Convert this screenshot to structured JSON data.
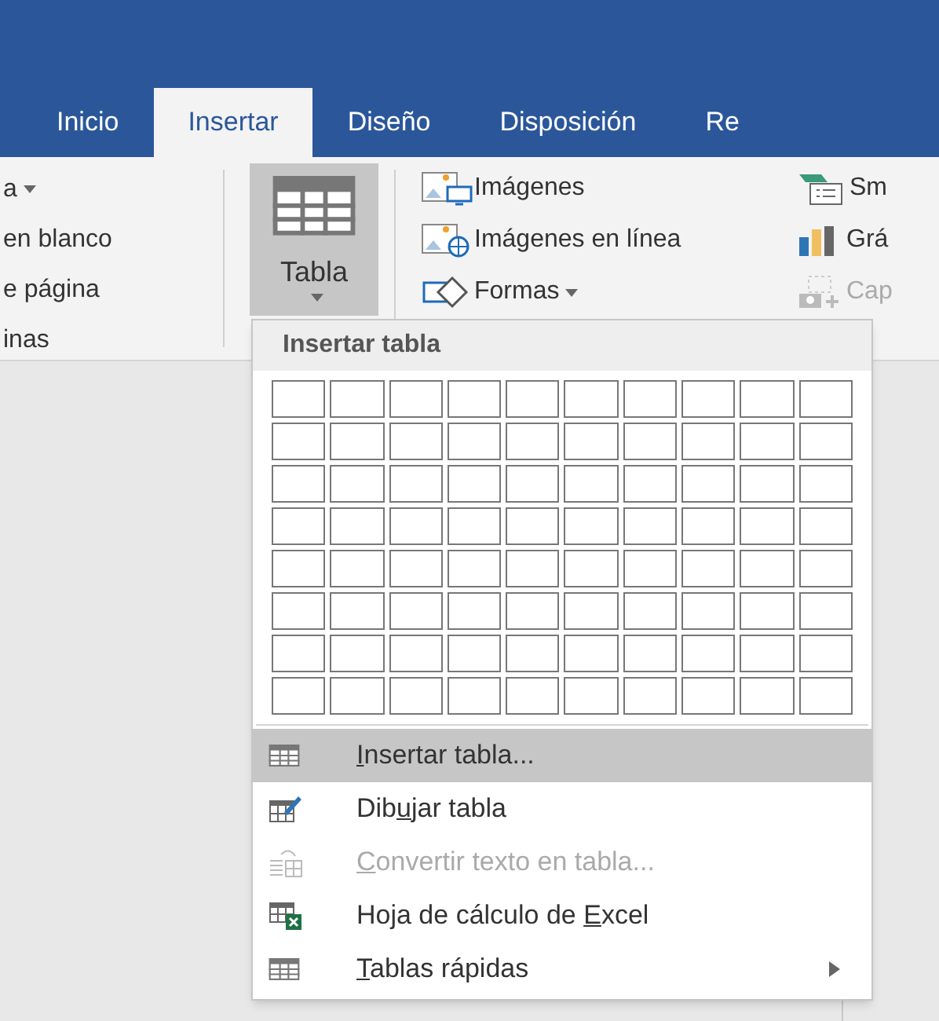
{
  "tabs": [
    {
      "label": "Inicio",
      "selected": false
    },
    {
      "label": "Insertar",
      "selected": true
    },
    {
      "label": "Diseño",
      "selected": false
    },
    {
      "label": "Disposición",
      "selected": false
    },
    {
      "label": "Re",
      "selected": false
    }
  ],
  "left_group": [
    {
      "label": "a",
      "dropdown": true
    },
    {
      "label": "en blanco",
      "dropdown": false
    },
    {
      "label": "e página",
      "dropdown": false
    },
    {
      "label": "inas",
      "dropdown": false
    }
  ],
  "table_button": {
    "label": "Tabla",
    "selected": true
  },
  "illustrations": [
    {
      "kind": "pictures",
      "label": "Imágenes",
      "dropdown": false
    },
    {
      "kind": "online",
      "label": "Imágenes en línea",
      "dropdown": false
    },
    {
      "kind": "shapes",
      "label": "Formas",
      "dropdown": true
    }
  ],
  "right_group": [
    {
      "kind": "smartart",
      "label": "Sm",
      "disabled": false
    },
    {
      "kind": "chart",
      "label": "Grá",
      "disabled": false
    },
    {
      "kind": "screenshot",
      "label": "Cap",
      "disabled": true
    }
  ],
  "menu": {
    "header": "Insertar tabla",
    "items": [
      {
        "kind": "insert",
        "access_key": "I",
        "after": "nsertar tabla...",
        "selected": true,
        "disabled": false,
        "submenu": false
      },
      {
        "kind": "draw",
        "before": "Dib",
        "access_key": "u",
        "after": "jar tabla",
        "selected": false,
        "disabled": false,
        "submenu": false
      },
      {
        "kind": "convert",
        "access_key": "C",
        "after": "onvertir texto en tabla...",
        "selected": false,
        "disabled": true,
        "submenu": false
      },
      {
        "kind": "excel",
        "before": "Hoja de cálculo de ",
        "access_key": "E",
        "after": "xcel",
        "selected": false,
        "disabled": false,
        "submenu": false
      },
      {
        "kind": "quick",
        "access_key": "T",
        "after": "ablas rápidas",
        "selected": false,
        "disabled": false,
        "submenu": true
      }
    ]
  }
}
